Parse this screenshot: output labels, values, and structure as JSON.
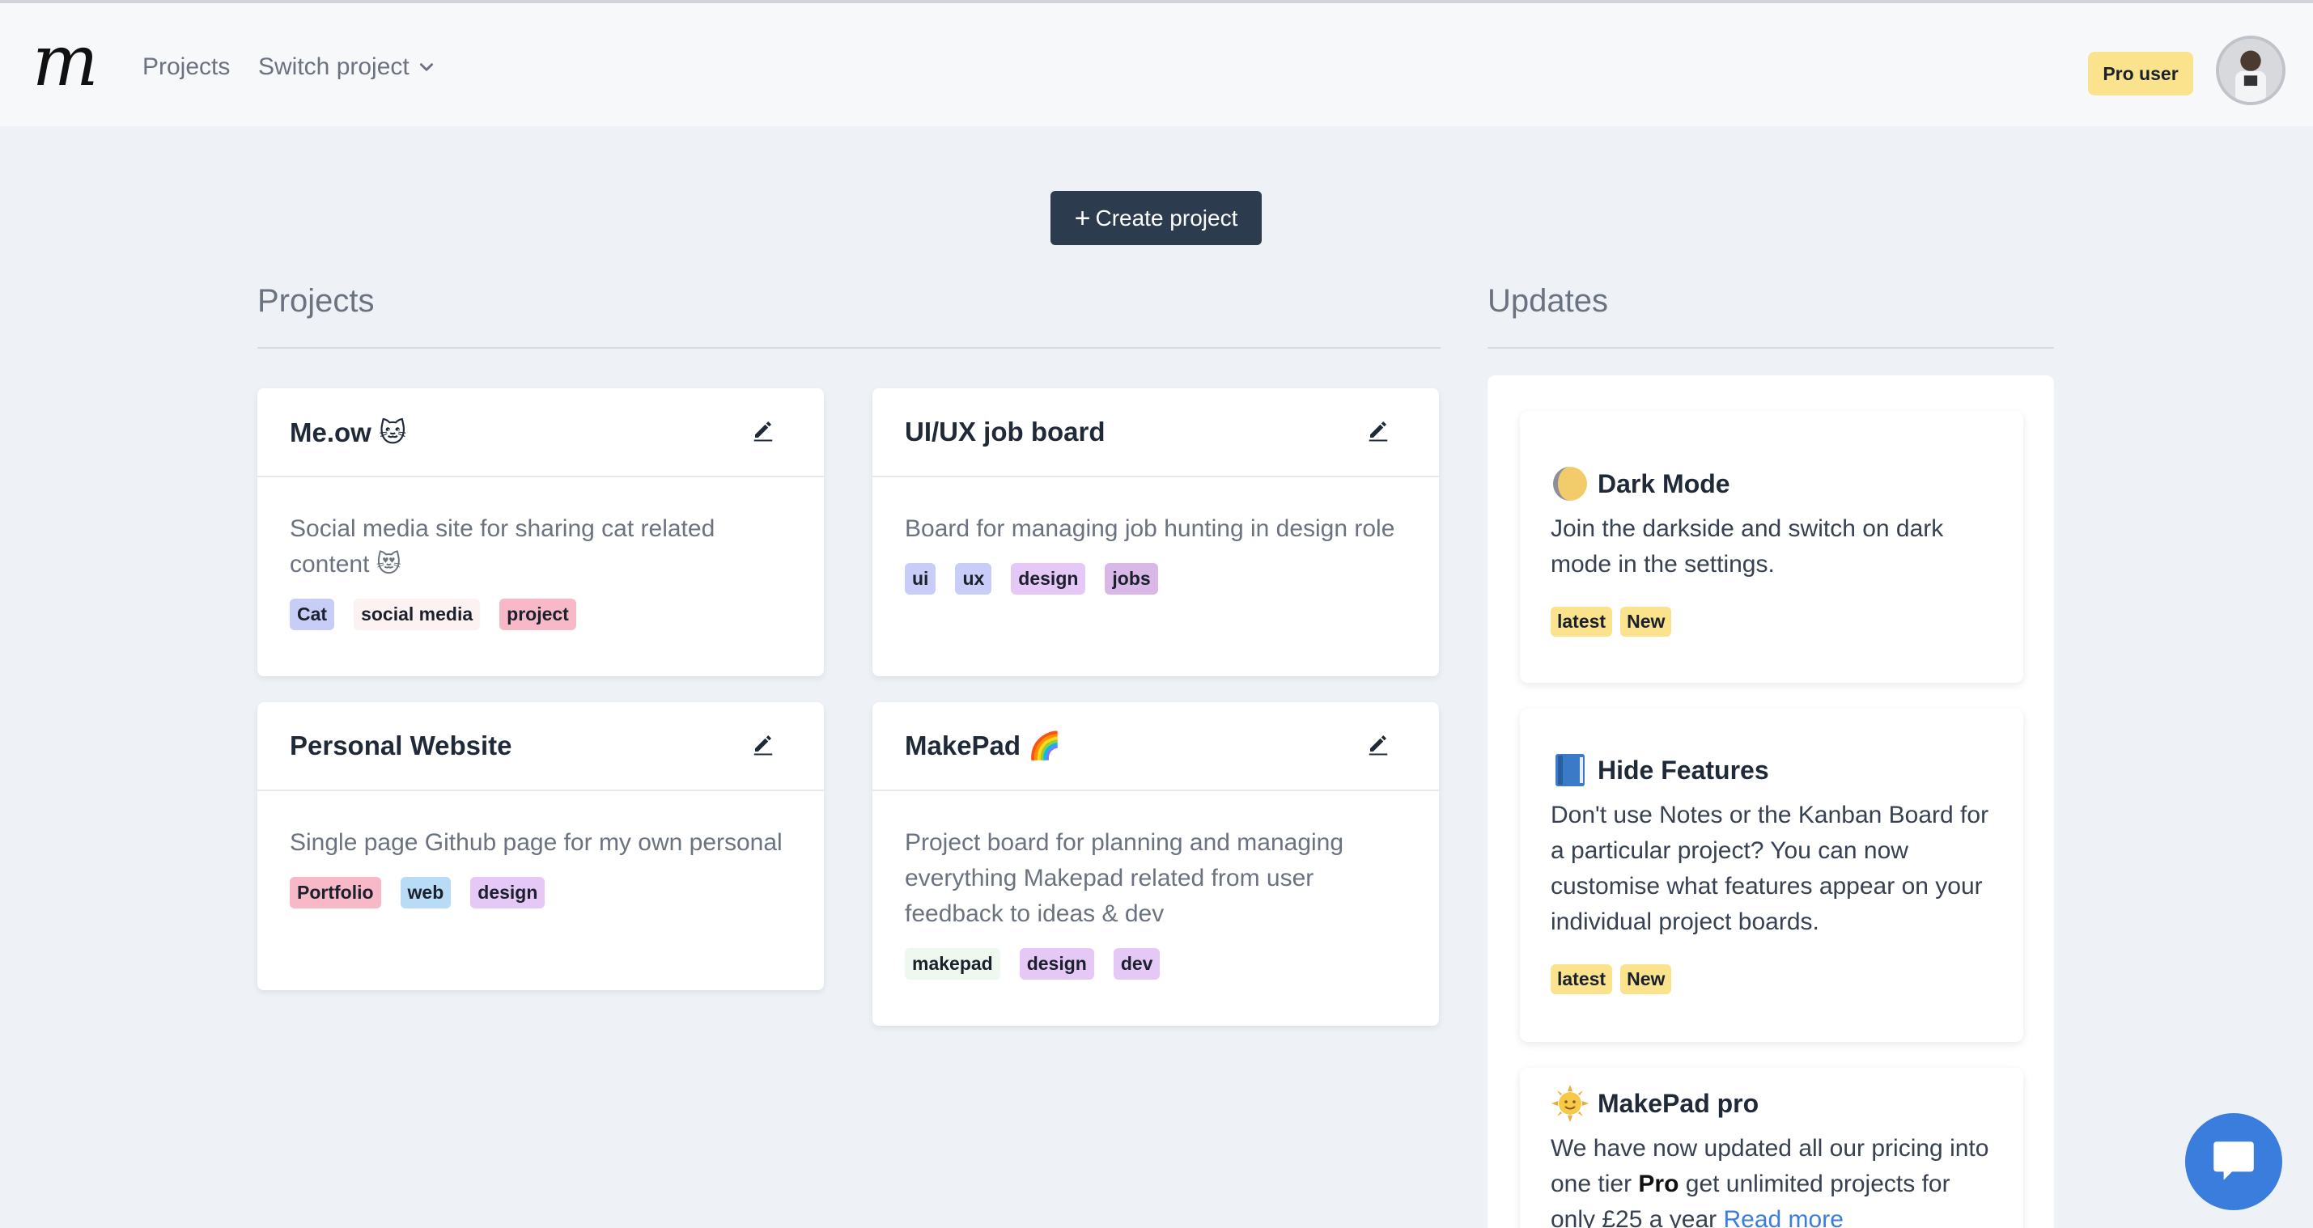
{
  "header": {
    "logo_text": "m",
    "nav_projects": "Projects",
    "nav_switch": "Switch project",
    "pro_badge": "Pro user"
  },
  "create_button": "Create project",
  "sections": {
    "projects_title": "Projects",
    "updates_title": "Updates"
  },
  "projects": [
    {
      "title": "Me.ow 🐱",
      "description": "Social media site for sharing cat related content 😻",
      "tags": [
        {
          "label": "Cat",
          "color": "#c8cdf7"
        },
        {
          "label": "social media",
          "color": "#fdf2f2"
        },
        {
          "label": "project",
          "color": "#f7b8c8"
        }
      ]
    },
    {
      "title": "UI/UX job board",
      "description": "Board for managing job hunting in design role",
      "tags": [
        {
          "label": "ui",
          "color": "#c8cdf7"
        },
        {
          "label": "ux",
          "color": "#c8cdf7"
        },
        {
          "label": "design",
          "color": "#e6c8f7"
        },
        {
          "label": "jobs",
          "color": "#d9b8e8"
        }
      ]
    },
    {
      "title": "Personal Website",
      "description": "Single page Github page for my own personal",
      "tags": [
        {
          "label": "Portfolio",
          "color": "#f7b8c8"
        },
        {
          "label": "web",
          "color": "#b8dcf5"
        },
        {
          "label": "design",
          "color": "#e6c8f7"
        }
      ]
    },
    {
      "title": "MakePad 🌈",
      "description": "Project board for planning and managing everything Makepad related from user feedback to ideas & dev",
      "tags": [
        {
          "label": "makepad",
          "color": "#eef8ee"
        },
        {
          "label": "design",
          "color": "#e6c8f7"
        },
        {
          "label": "dev",
          "color": "#e6c8f7"
        }
      ]
    }
  ],
  "updates": [
    {
      "icon": "moon-icon",
      "title": "Dark Mode",
      "text": "Join the darkside and switch on dark mode in the settings.",
      "tags": [
        "latest",
        "New"
      ]
    },
    {
      "icon": "book-icon",
      "title": "Hide Features",
      "text": "Don't use Notes or the Kanban Board for a particular project? You can now customise what features appear on your individual project boards.",
      "tags": [
        "latest",
        "New"
      ]
    },
    {
      "icon": "sun-icon",
      "title": "MakePad pro",
      "text_a": "We have now updated all our pricing into one tier ",
      "text_bold": "Pro",
      "text_b": " get unlimited projects for only £25 a year ",
      "text_link": "Read more"
    }
  ],
  "colors": {
    "accent": "#3b7ddd",
    "button": "#2d3b4e",
    "badge": "#fbe38e"
  }
}
